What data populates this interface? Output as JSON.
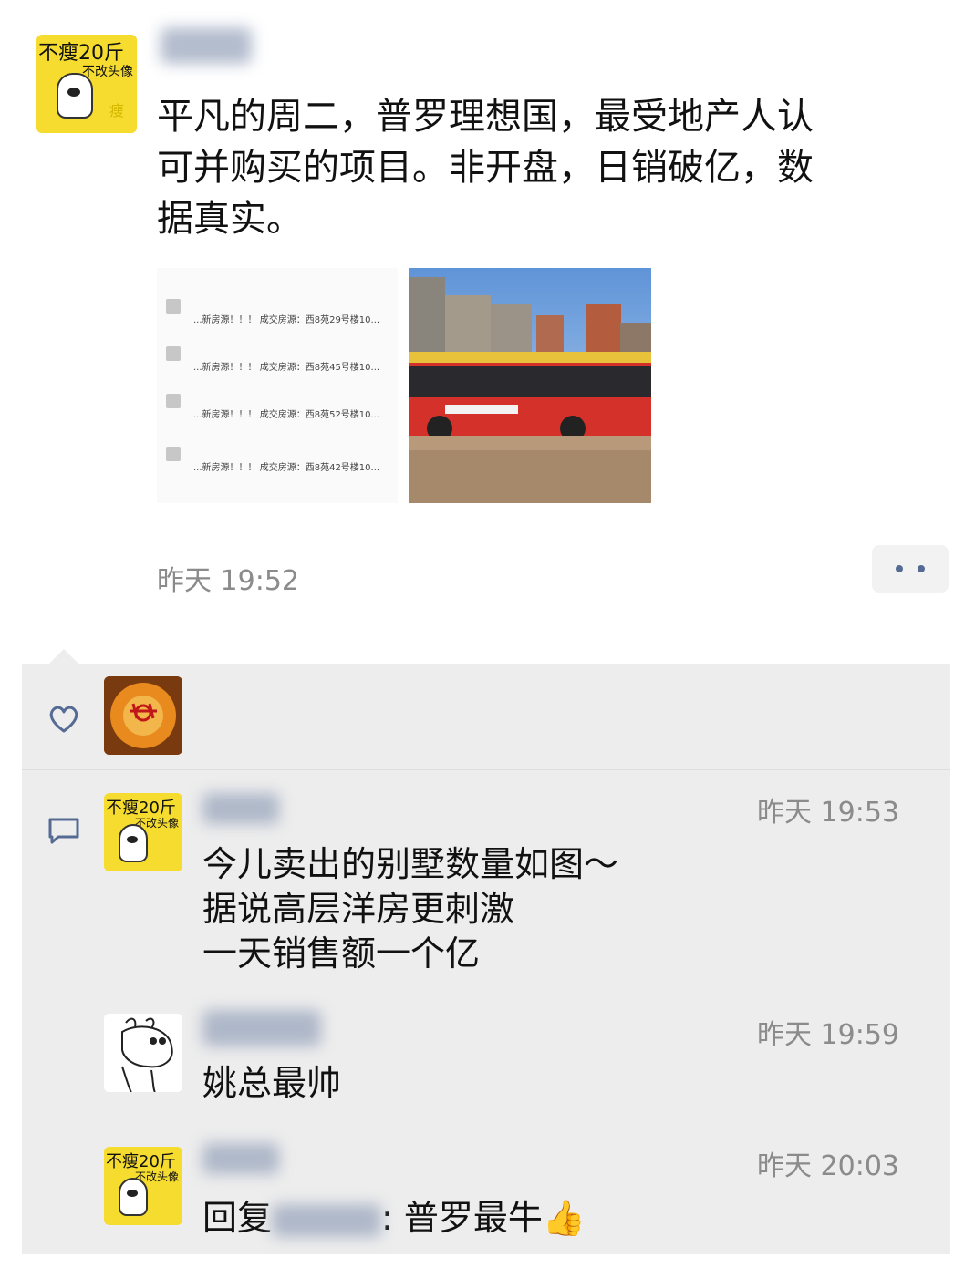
{
  "post": {
    "author_avatar": {
      "line1": "不瘦20斤",
      "line2": "不改头像"
    },
    "text": "平凡的周二，普罗理想国，最受地产人认可并购买的项目。非开盘，日销破亿，数据真实。",
    "lines": [
      "平凡的周二，普罗理想国，最受地产人认",
      "可并购买的项目。非开盘，日销破亿，数",
      "据真实。"
    ],
    "time": "昨天 19:52",
    "thumb_left_rows": [
      "...新房源！！！ 成交房源：西8苑29号楼10...",
      "...新房源！！！ 成交房源：西8苑45号楼10...",
      "...新房源！！！ 成交房源：西8苑52号楼10...",
      "...新房源！！！ 成交房源：西8苑42号楼10..."
    ]
  },
  "comments": [
    {
      "avatar": {
        "line1": "不瘦20斤",
        "line2": "不改头像"
      },
      "time": "昨天 19:53",
      "lines": [
        "今儿卖出的别墅数量如图～",
        "据说高层洋房更刺激",
        "一天销售额一个亿"
      ]
    },
    {
      "time": "昨天 19:59",
      "lines": [
        "姚总最帅"
      ]
    },
    {
      "avatar": {
        "line1": "不瘦20斤",
        "line2": "不改头像"
      },
      "time": "昨天 20:03",
      "reply_prefix": "回复",
      "reply_text": ": 普罗最牛👍"
    }
  ],
  "colors": {
    "accent": "#566b94",
    "panel": "#ededed",
    "time": "#8b8b8b"
  },
  "icons": {
    "like": "heart-icon",
    "comment": "comment-icon",
    "more": "more-dots-icon"
  }
}
